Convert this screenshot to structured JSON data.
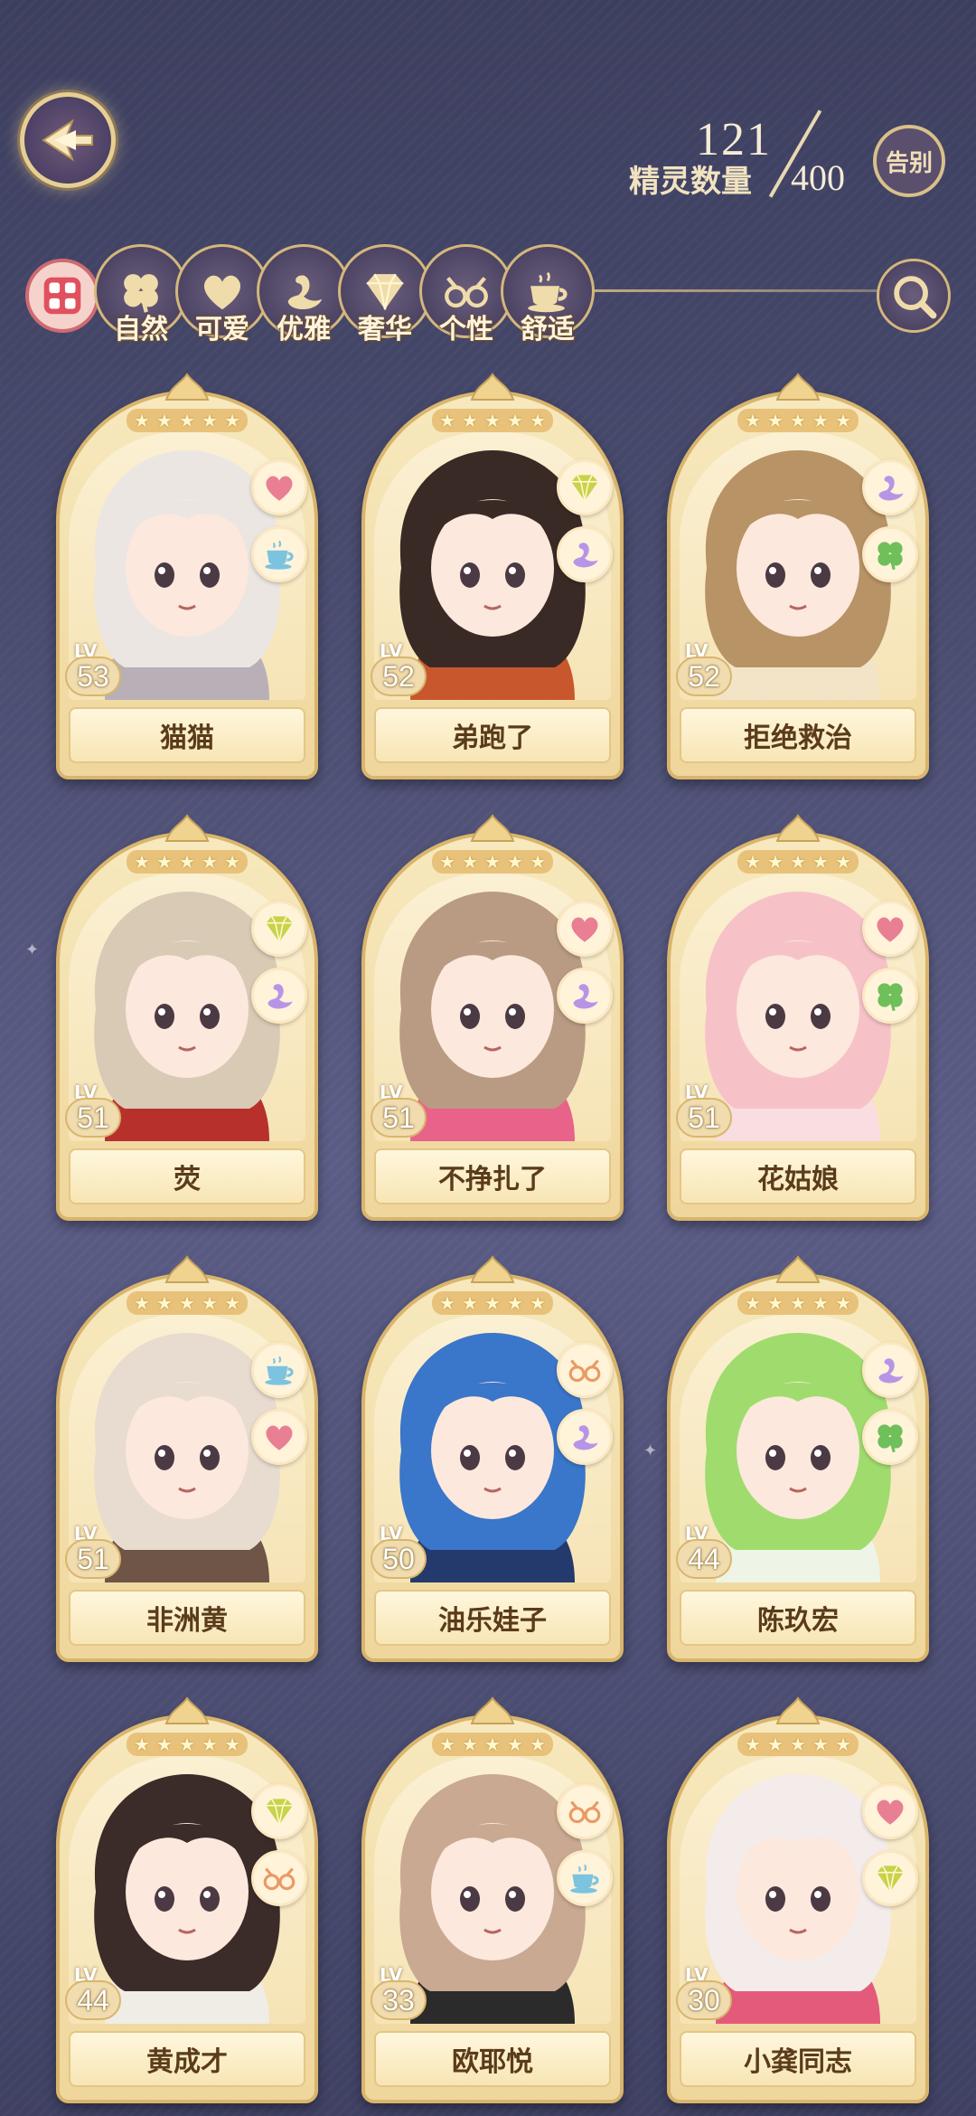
{
  "header": {
    "spirit_count_current": "121",
    "spirit_count_max": "400",
    "spirit_count_label": "精灵数量",
    "farewell_label": "告别"
  },
  "filters": [
    {
      "label": "",
      "icon": "grid-icon",
      "selected": true
    },
    {
      "label": "自然",
      "icon": "clover-icon"
    },
    {
      "label": "可爱",
      "icon": "heart-icon"
    },
    {
      "label": "优雅",
      "icon": "swan-icon"
    },
    {
      "label": "奢华",
      "icon": "diamond-icon"
    },
    {
      "label": "个性",
      "icon": "glasses-icon"
    },
    {
      "label": "舒适",
      "icon": "teacup-icon"
    },
    {
      "label": "",
      "icon": "search-icon"
    }
  ],
  "cards": [
    {
      "name": "猫猫",
      "level": "53",
      "lv_label": "LV",
      "stars": 5,
      "traits": [
        "heart-icon",
        "teacup-icon"
      ],
      "hair": "#ece6e2",
      "accent": "#b8b0b6"
    },
    {
      "name": "弟跑了",
      "level": "52",
      "lv_label": "LV",
      "stars": 5,
      "traits": [
        "diamond-icon",
        "swan-icon"
      ],
      "hair": "#3a2a26",
      "accent": "#c9572e"
    },
    {
      "name": "拒绝救治",
      "level": "52",
      "lv_label": "LV",
      "stars": 5,
      "traits": [
        "swan-icon",
        "clover-icon"
      ],
      "hair": "#b89366",
      "accent": "#f3e4c8"
    },
    {
      "name": "荧",
      "level": "51",
      "lv_label": "LV",
      "stars": 5,
      "traits": [
        "diamond-icon",
        "swan-icon"
      ],
      "hair": "#d9cab6",
      "accent": "#b8302c"
    },
    {
      "name": "不挣扎了",
      "level": "51",
      "lv_label": "LV",
      "stars": 5,
      "traits": [
        "heart-icon",
        "swan-icon"
      ],
      "hair": "#b99b84",
      "accent": "#e9628a"
    },
    {
      "name": "花姑娘",
      "level": "51",
      "lv_label": "LV",
      "stars": 5,
      "traits": [
        "heart-icon",
        "clover-icon"
      ],
      "hair": "#f6c2c8",
      "accent": "#f8dde1"
    },
    {
      "name": "非洲黄",
      "level": "51",
      "lv_label": "LV",
      "stars": 5,
      "traits": [
        "teacup-icon",
        "heart-icon"
      ],
      "hair": "#e7dccf",
      "accent": "#6f5448"
    },
    {
      "name": "油乐娃子",
      "level": "50",
      "lv_label": "LV",
      "stars": 5,
      "traits": [
        "glasses-icon",
        "swan-icon"
      ],
      "hair": "#3a76c9",
      "accent": "#24396c"
    },
    {
      "name": "陈玖宏",
      "level": "44",
      "lv_label": "LV",
      "stars": 5,
      "traits": [
        "swan-icon",
        "clover-icon"
      ],
      "hair": "#9fdc6d",
      "accent": "#eef4e6"
    },
    {
      "name": "黄成才",
      "level": "44",
      "lv_label": "LV",
      "stars": 5,
      "traits": [
        "diamond-icon",
        "glasses-icon"
      ],
      "hair": "#3b2c2a",
      "accent": "#f0ece6"
    },
    {
      "name": "欧耶悦",
      "level": "33",
      "lv_label": "LV",
      "stars": 5,
      "traits": [
        "glasses-icon",
        "teacup-icon"
      ],
      "hair": "#c9a991",
      "accent": "#2b2b2b"
    },
    {
      "name": "小龚同志",
      "level": "30",
      "lv_label": "LV",
      "stars": 5,
      "traits": [
        "heart-icon",
        "diamond-icon"
      ],
      "hair": "#f4ecea",
      "accent": "#e35a7a"
    }
  ],
  "colors": {
    "heart": "#e97f92",
    "clover": "#6fbf5a",
    "swan": "#b894e6",
    "diamond": "#c8d24a",
    "glasses": "#e99a65",
    "teacup": "#7cc3e0"
  }
}
